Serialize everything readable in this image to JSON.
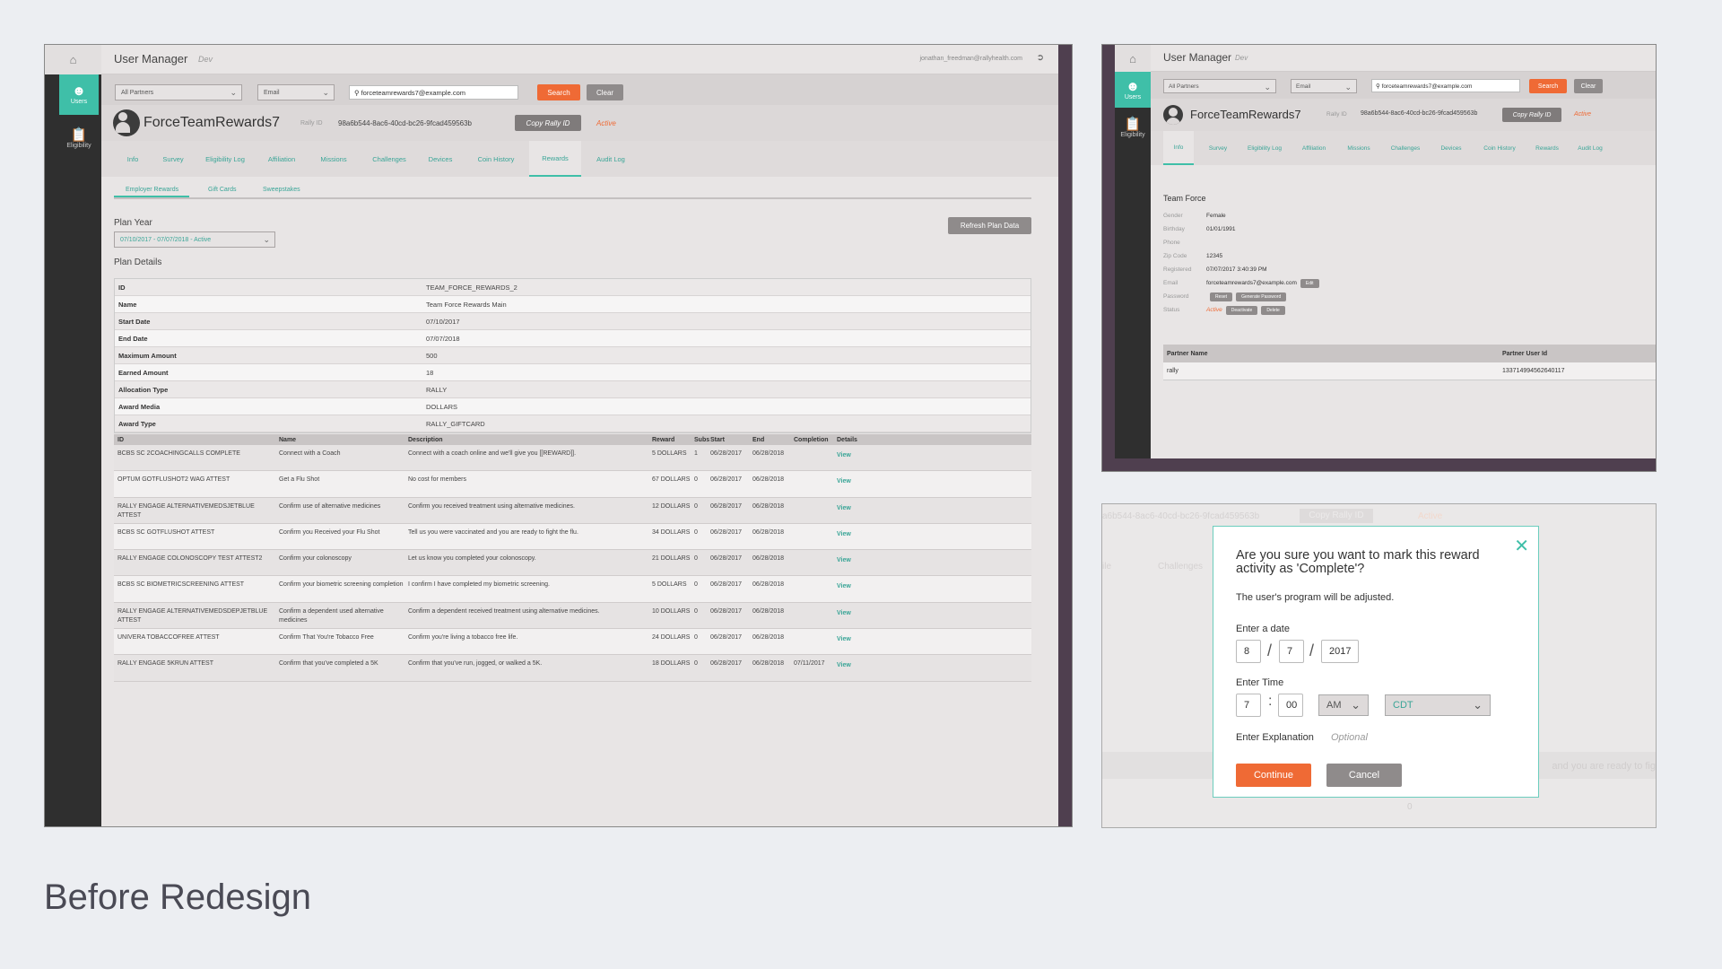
{
  "caption": "Before Redesign",
  "app": {
    "title": "User Manager",
    "env": "Dev",
    "user_email": "jonathan_freedman@rallyhealth.com",
    "sidebar": [
      {
        "label": "Users",
        "icon": "users-icon"
      },
      {
        "label": "Eligibility",
        "icon": "clipboard-icon"
      }
    ],
    "search": {
      "partner": "All Partners",
      "field": "Email",
      "query": "forceteamrewards7@example.com",
      "search_label": "Search",
      "clear_label": "Clear"
    },
    "profile": {
      "name": "ForceTeamRewards7",
      "rally_label": "Rally ID",
      "rally_id": "98a6b544-8ac6-40cd-bc26-9fcad459563b",
      "copy_label": "Copy Rally ID",
      "status": "Active"
    },
    "tabs": [
      "Info",
      "Survey",
      "Eligibility Log",
      "Affiliation",
      "Missions",
      "Challenges",
      "Devices",
      "Coin History",
      "Rewards",
      "Audit Log"
    ]
  },
  "rewards_screen": {
    "active_tab": "Rewards",
    "subtabs": [
      "Employer Rewards",
      "Gift Cards",
      "Sweepstakes"
    ],
    "plan_year_label": "Plan Year",
    "plan_year_value": "07/10/2017 - 07/07/2018 - Active",
    "refresh_label": "Refresh Plan Data",
    "plan_details_label": "Plan Details",
    "plan_details": [
      {
        "k": "ID",
        "v": "TEAM_FORCE_REWARDS_2"
      },
      {
        "k": "Name",
        "v": "Team Force Rewards Main"
      },
      {
        "k": "Start Date",
        "v": "07/10/2017"
      },
      {
        "k": "End Date",
        "v": "07/07/2018"
      },
      {
        "k": "Maximum Amount",
        "v": "500"
      },
      {
        "k": "Earned Amount",
        "v": "18"
      },
      {
        "k": "Allocation Type",
        "v": "RALLY"
      },
      {
        "k": "Award Media",
        "v": "DOLLARS"
      },
      {
        "k": "Award Type",
        "v": "RALLY_GIFTCARD"
      }
    ],
    "activity_columns": [
      "ID",
      "Name",
      "Description",
      "Reward",
      "Subs",
      "Start",
      "End",
      "Completion",
      "Details"
    ],
    "activities": [
      {
        "id": "BCBS SC 2COACHINGCALLS COMPLETE",
        "name": "Connect with a Coach",
        "desc": "Connect with a coach online and we'll give you [[REWARD]].",
        "reward": "5 DOLLARS",
        "subs": "1",
        "start": "06/28/2017",
        "end": "06/28/2018",
        "completion": "",
        "details": "View"
      },
      {
        "id": "OPTUM GOTFLUSHOT2 WAG ATTEST",
        "name": "Get a Flu Shot",
        "desc": "No cost for members",
        "reward": "67 DOLLARS",
        "subs": "0",
        "start": "06/28/2017",
        "end": "06/28/2018",
        "completion": "",
        "details": "View"
      },
      {
        "id": "RALLY ENGAGE ALTERNATIVEMEDSJETBLUE ATTEST",
        "name": "Confirm use of alternative medicines",
        "desc": "Confirm you received treatment using alternative medicines.",
        "reward": "12 DOLLARS",
        "subs": "0",
        "start": "06/28/2017",
        "end": "06/28/2018",
        "completion": "",
        "details": "View"
      },
      {
        "id": "BCBS SC GOTFLUSHOT ATTEST",
        "name": "Confirm you Received your Flu Shot",
        "desc": "Tell us you were vaccinated and you are ready to fight the flu.",
        "reward": "34 DOLLARS",
        "subs": "0",
        "start": "06/28/2017",
        "end": "06/28/2018",
        "completion": "",
        "details": "View"
      },
      {
        "id": "RALLY ENGAGE COLONOSCOPY TEST ATTEST2",
        "name": "Confirm your colonoscopy",
        "desc": "Let us know you completed your colonoscopy.",
        "reward": "21 DOLLARS",
        "subs": "0",
        "start": "06/28/2017",
        "end": "06/28/2018",
        "completion": "",
        "details": "View"
      },
      {
        "id": "BCBS SC BIOMETRICSCREENING ATTEST",
        "name": "Confirm your biometric screening completion",
        "desc": "I confirm I have completed my biometric screening.",
        "reward": "5 DOLLARS",
        "subs": "0",
        "start": "06/28/2017",
        "end": "06/28/2018",
        "completion": "",
        "details": "View"
      },
      {
        "id": "RALLY ENGAGE ALTERNATIVEMEDSDEPJETBLUE ATTEST",
        "name": "Confirm a dependent used alternative medicines",
        "desc": "Confirm a dependent received treatment using alternative medicines.",
        "reward": "10 DOLLARS",
        "subs": "0",
        "start": "06/28/2017",
        "end": "06/28/2018",
        "completion": "",
        "details": "View"
      },
      {
        "id": "UNIVERA TOBACCOFREE ATTEST",
        "name": "Confirm That You're Tobacco Free",
        "desc": "Confirm you're living a tobacco free life.",
        "reward": "24 DOLLARS",
        "subs": "0",
        "start": "06/28/2017",
        "end": "06/28/2018",
        "completion": "",
        "details": "View"
      },
      {
        "id": "RALLY ENGAGE 5KRUN ATTEST",
        "name": "Confirm that you've completed a 5K",
        "desc": "Confirm that you've run, jogged, or walked a 5K.",
        "reward": "18 DOLLARS",
        "subs": "0",
        "start": "06/28/2017",
        "end": "06/28/2018",
        "completion": "07/11/2017",
        "details": "View"
      }
    ]
  },
  "info_screen": {
    "active_tab": "Info",
    "team": "Team Force",
    "fields": [
      {
        "k": "Gender",
        "v": "Female"
      },
      {
        "k": "Birthday",
        "v": "01/01/1991"
      },
      {
        "k": "Phone",
        "v": ""
      },
      {
        "k": "Zip Code",
        "v": "12345"
      },
      {
        "k": "Registered",
        "v": "07/07/2017 3:40:39 PM"
      },
      {
        "k": "Email",
        "v": "forceteamrewards7@example.com"
      },
      {
        "k": "Password",
        "v": ""
      },
      {
        "k": "Status",
        "v": "Active"
      }
    ],
    "edit_label": "Edit",
    "reset_label": "Reset",
    "generate_label": "Generate Password",
    "deactivate_label": "Deactivate",
    "delete_label": "Delete",
    "partner_columns": [
      "Partner Name",
      "Partner User Id"
    ],
    "partners": [
      {
        "name": "rally",
        "id": "133714994562640117"
      }
    ]
  },
  "dialog_screen": {
    "bg_rally_id": "a6b544-8ac6-40cd-bc26-9fcad459563b",
    "bg_copy": "Copy Rally ID",
    "bg_active": "Active",
    "bg_tab1": "ile",
    "bg_tab2": "Challenges",
    "bg_text": "and you are ready to fig",
    "bg_zero": "0",
    "title": "Are you sure you want to mark this reward activity as 'Complete'?",
    "subtitle": "The user's program will be adjusted.",
    "date_label": "Enter a date",
    "month": "8",
    "day": "7",
    "year": "2017",
    "time_label": "Enter Time",
    "hour": "7",
    "minute": "00",
    "ampm": "AM",
    "tz": "CDT",
    "explanation_label": "Enter Explanation",
    "explanation_placeholder": "Optional",
    "continue_label": "Continue",
    "cancel_label": "Cancel"
  }
}
